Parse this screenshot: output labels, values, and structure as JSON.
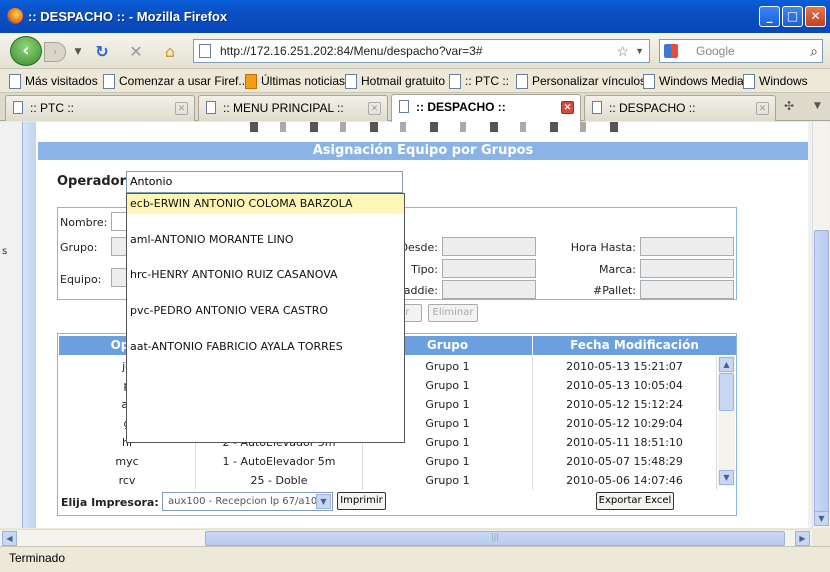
{
  "window": {
    "title": ":: DESPACHO :: - Mozilla Firefox"
  },
  "nav": {
    "url": "http://172.16.251.202:84/Menu/despacho?var=3#",
    "search_placeholder": "Google"
  },
  "bookmarks": [
    "Más visitados",
    "Comenzar a usar Firef...",
    "Últimas noticias",
    "Hotmail gratuito",
    ":: PTC ::",
    "Personalizar vínculos",
    "Windows Media",
    "Windows"
  ],
  "tabs": [
    ":: PTC ::",
    ":: MENU PRINCIPAL ::",
    ":: DESPACHO ::",
    ":: DESPACHO ::"
  ],
  "section_title": "Asignación Equipo por Grupos",
  "operator": {
    "label": "Operador:",
    "value": "Antonio"
  },
  "form": {
    "nombre": "Nombre:",
    "grupo": "Grupo:",
    "equipo": "Equipo:",
    "desde": "Desde:",
    "tipo": "Tipo:",
    "paddie": "addie:",
    "hora_hasta": "Hora Hasta:",
    "marca": "Marca:",
    "pallet": "#Pallet:",
    "btn_modificar": "car",
    "btn_eliminar": "Eliminar"
  },
  "suggestions": [
    "ecb-ERWIN ANTONIO COLOMA BARZOLA",
    "aml-ANTONIO MORANTE LINO",
    "hrc-HENRY ANTONIO RUIZ CASANOVA",
    "pvc-PEDRO ANTONIO VERA CASTRO",
    "aat-ANTONIO FABRICIO AYALA TORRES"
  ],
  "grid": {
    "headers": [
      "Oper",
      "",
      "Grupo",
      "Fecha Modificación"
    ],
    "rows": [
      {
        "op": "je",
        "equipo": "",
        "grupo": "Grupo 1",
        "fecha": "2010-05-13 15:21:07"
      },
      {
        "op": "p",
        "equipo": "",
        "grupo": "Grupo 1",
        "fecha": "2010-05-13 10:05:04"
      },
      {
        "op": "ar",
        "equipo": "",
        "grupo": "Grupo 1",
        "fecha": "2010-05-12 15:12:24"
      },
      {
        "op": "g",
        "equipo": "",
        "grupo": "Grupo 1",
        "fecha": "2010-05-12 10:29:04"
      },
      {
        "op": "hl",
        "equipo": "2 - AutoElevador 5m",
        "grupo": "Grupo 1",
        "fecha": "2010-05-11 18:51:10"
      },
      {
        "op": "myc",
        "equipo": "1 - AutoElevador 5m",
        "grupo": "Grupo 1",
        "fecha": "2010-05-07 15:48:29"
      },
      {
        "op": "rcv",
        "equipo": "25 - Doble",
        "grupo": "Grupo 1",
        "fecha": "2010-05-06 14:07:46"
      }
    ]
  },
  "footer": {
    "printer_label": "Elija Impresora:",
    "printer_value": "aux100 - Recepcion lp 67/a100",
    "print_button": "Imprimir",
    "export_button": "Exportar Excel"
  },
  "status": "Terminado"
}
